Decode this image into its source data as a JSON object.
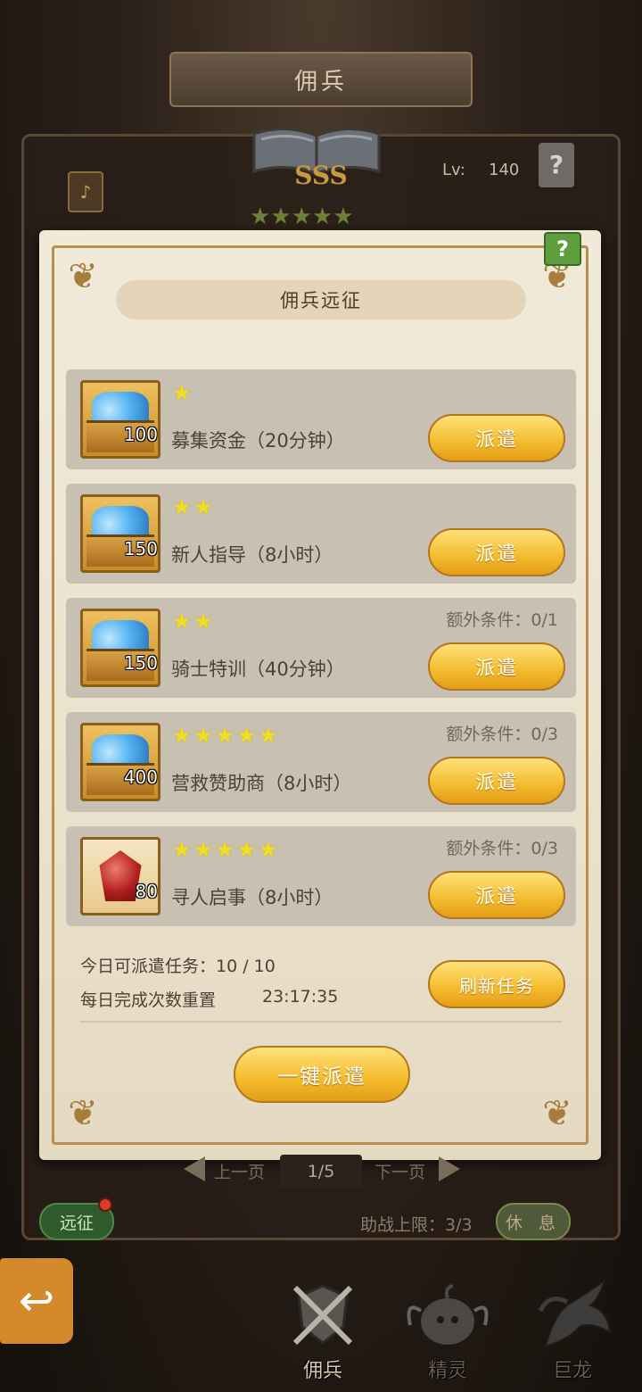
{
  "header": {
    "title": "佣兵",
    "rank": "SSS",
    "stars": "★★★★★",
    "lv_label": "Lv:",
    "lv_value": "140",
    "help_glyph": "?"
  },
  "panel": {
    "title": "佣兵远征",
    "help_glyph": "?",
    "tasks": [
      {
        "icon": "gem-chest-icon",
        "quantity": "100",
        "stars": "★",
        "name": "募集资金（20分钟）",
        "extra": "",
        "button": "派遣"
      },
      {
        "icon": "gem-chest-icon",
        "quantity": "150",
        "stars": "★★",
        "name": "新人指导（8小时）",
        "extra": "",
        "button": "派遣"
      },
      {
        "icon": "gem-chest-icon",
        "quantity": "150",
        "stars": "★★",
        "name": "骑士特训（40分钟）",
        "extra": "额外条件：0/1",
        "button": "派遣"
      },
      {
        "icon": "gem-chest-icon",
        "quantity": "400",
        "stars": "★★★★★",
        "name": "营救赞助商（8小时）",
        "extra": "额外条件：0/3",
        "button": "派遣"
      },
      {
        "icon": "ruby-crystal-icon",
        "quantity": "80",
        "stars": "★★★★★",
        "name": "寻人启事（8小时）",
        "extra": "额外条件：0/3",
        "button": "派遣"
      }
    ],
    "daily_tasks_label": "今日可派遣任务：10 / 10",
    "reset_label": "每日完成次数重置",
    "reset_timer": "23:17:35",
    "refresh_button": "刷新任务",
    "one_click_button": "一键派遣"
  },
  "background": {
    "prev_page": "上一页",
    "page_indicator": "1/5",
    "next_page": "下一页",
    "expedition_button": "远征",
    "assist_limit": "助战上限：3/3",
    "rest_button": "休 息"
  },
  "bottom_nav": {
    "items": [
      {
        "label": "佣兵",
        "icon": "crossed-swords-shield-icon"
      },
      {
        "label": "精灵",
        "icon": "spirit-blob-icon"
      },
      {
        "label": "巨龙",
        "icon": "dragon-icon"
      }
    ]
  },
  "colors": {
    "parchment": "#ebe2cd",
    "button_gold": "#f3bb2c",
    "star_yellow": "#f2dc2a",
    "row_gray": "#c8c1b3"
  }
}
